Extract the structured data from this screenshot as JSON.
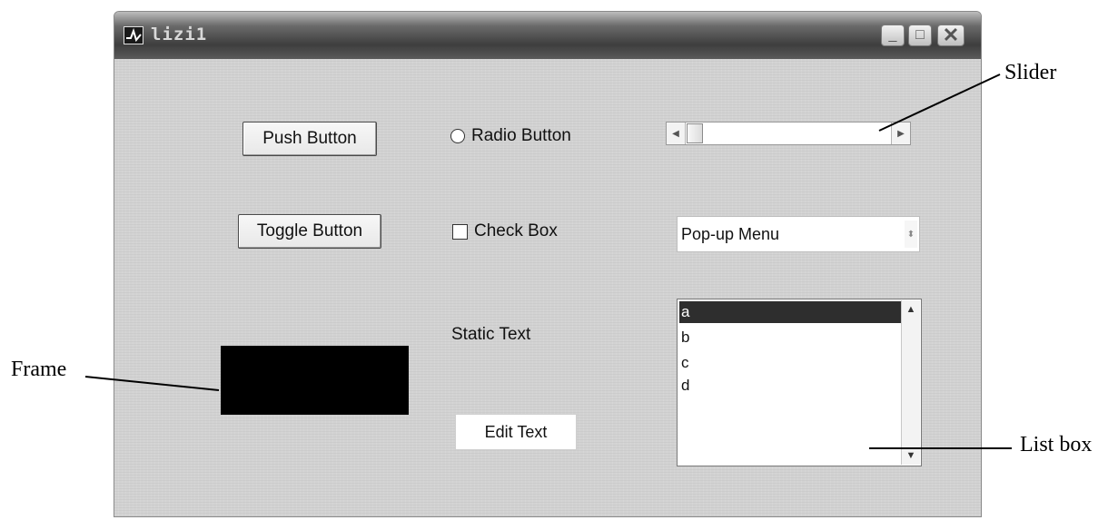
{
  "window": {
    "title": "lizi1",
    "icon": "matlab-figure-icon",
    "controls": [
      "minimize-icon",
      "maximize-icon",
      "close-icon"
    ]
  },
  "controls": {
    "push_button": "Push Button",
    "toggle_button": "Toggle Button",
    "radio_button": "Radio Button",
    "check_box": "Check Box",
    "static_text": "Static Text",
    "edit_text": "Edit Text",
    "popup_menu": {
      "selected": "Pop-up Menu"
    },
    "listbox": {
      "items": [
        "a",
        "b",
        "c",
        "d"
      ],
      "selected_index": 0
    },
    "slider": {
      "value": 0
    }
  },
  "annotations": {
    "slider": "Slider",
    "frame": "Frame",
    "list_box": "List box"
  },
  "colors": {
    "background": "#d2d2d2",
    "frame": "#000000",
    "list_selection": "#2e2e2e"
  }
}
